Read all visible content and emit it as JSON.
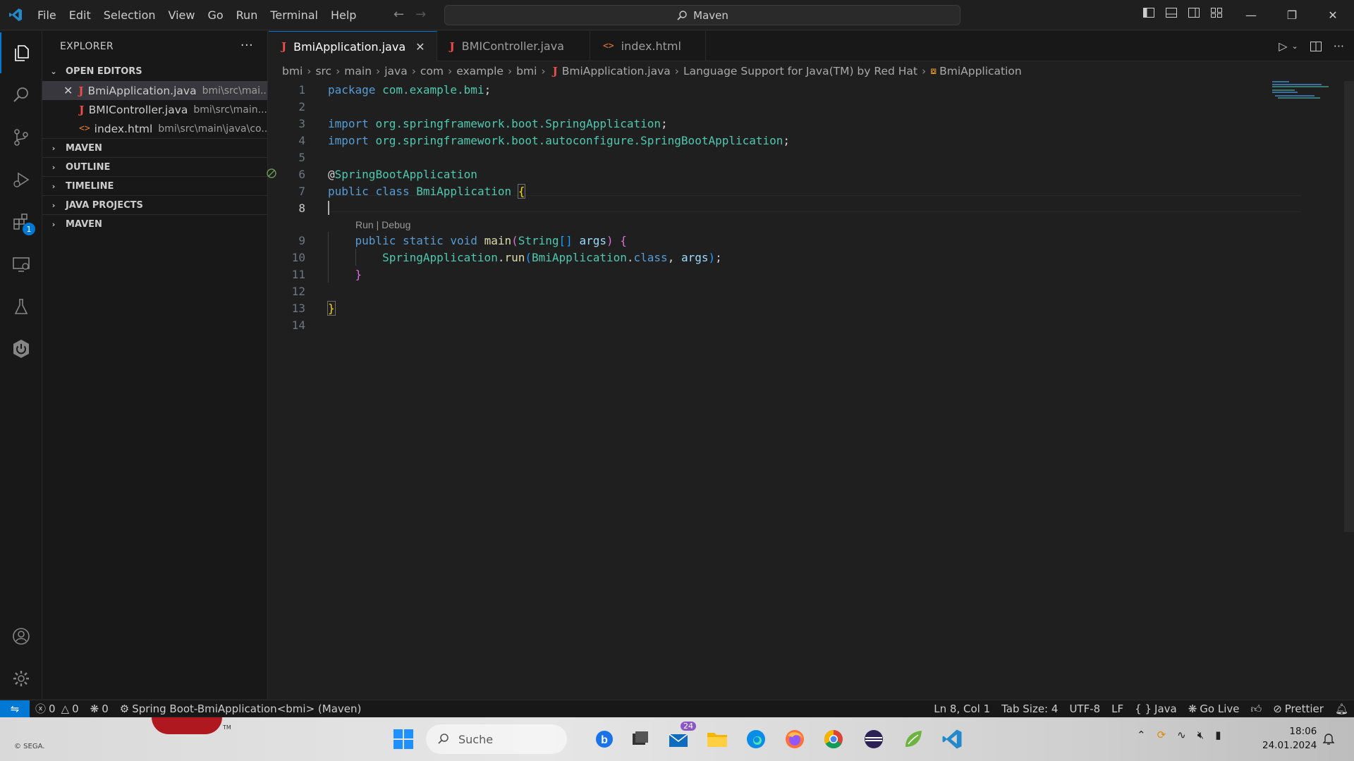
{
  "titlebar": {
    "menu": [
      "File",
      "Edit",
      "Selection",
      "View",
      "Go",
      "Run",
      "Terminal",
      "Help"
    ],
    "search_text": "Maven"
  },
  "activitybar": {
    "extensions_badge": "1"
  },
  "sidebar": {
    "title": "EXPLORER",
    "open_editors_label": "OPEN EDITORS",
    "open_editors": [
      {
        "name": "BmiApplication.java",
        "path": "bmi\\src\\mai...",
        "type": "java"
      },
      {
        "name": "BMIController.java",
        "path": "bmi\\src\\main...",
        "type": "java"
      },
      {
        "name": "index.html",
        "path": "bmi\\src\\main\\java\\co...",
        "type": "html"
      }
    ],
    "sections": [
      "MAVEN",
      "OUTLINE",
      "TIMELINE",
      "JAVA PROJECTS",
      "MAVEN"
    ]
  },
  "editor": {
    "tabs": [
      {
        "label": "BmiApplication.java",
        "type": "java",
        "active": true
      },
      {
        "label": "BMIController.java",
        "type": "java",
        "active": false
      },
      {
        "label": "index.html",
        "type": "html",
        "active": false
      }
    ],
    "breadcrumb": [
      "bmi",
      "src",
      "main",
      "java",
      "com",
      "example",
      "bmi",
      "BmiApplication.java",
      "Language Support for Java(TM) by Red Hat",
      "BmiApplication"
    ],
    "codelens": "Run | Debug",
    "line_numbers": [
      "1",
      "2",
      "3",
      "4",
      "5",
      "6",
      "7",
      "8",
      "9",
      "10",
      "11",
      "12",
      "13",
      "14"
    ],
    "code": {
      "l1_kw": "package",
      "l1_pkg": "com.example.bmi",
      "l3_kw": "import",
      "l3_a": "org.springframework.boot.",
      "l3_b": "SpringApplication",
      "l4_kw": "import",
      "l4_a": "org.springframework.boot.autoconfigure.",
      "l4_b": "SpringBootApplication",
      "l6_at": "@",
      "l6_anno": "SpringBootApplication",
      "l7_kw1": "public",
      "l7_kw2": "class",
      "l7_cls": "BmiApplication",
      "l9_kw1": "public",
      "l9_kw2": "static",
      "l9_kw3": "void",
      "l9_fn": "main",
      "l9_type": "String",
      "l9_arg": "args",
      "l10_cls": "SpringApplication",
      "l10_fn": "run",
      "l10_arg1": "BmiApplication",
      "l10_kw": "class",
      "l10_arg2": "args"
    }
  },
  "statusbar": {
    "errors": "0",
    "warnings": "0",
    "ports": "0",
    "spring_boot": "Spring Boot-BmiApplication<bmi> (Maven)",
    "position": "Ln 8, Col 1",
    "tab_size": "Tab Size: 4",
    "encoding": "UTF-8",
    "eol": "LF",
    "language": "Java",
    "go_live": "Go Live",
    "prettier": "Prettier"
  },
  "taskbar": {
    "search_placeholder": "Suche",
    "mail_badge": "24",
    "time": "18:06",
    "date": "24.01.2024",
    "wallpaper_credit": "© SEGA.",
    "tm": "TM"
  },
  "colors": {
    "accent": "#0078d4",
    "java_icon": "#f14c4c",
    "html_icon": "#e37933"
  }
}
